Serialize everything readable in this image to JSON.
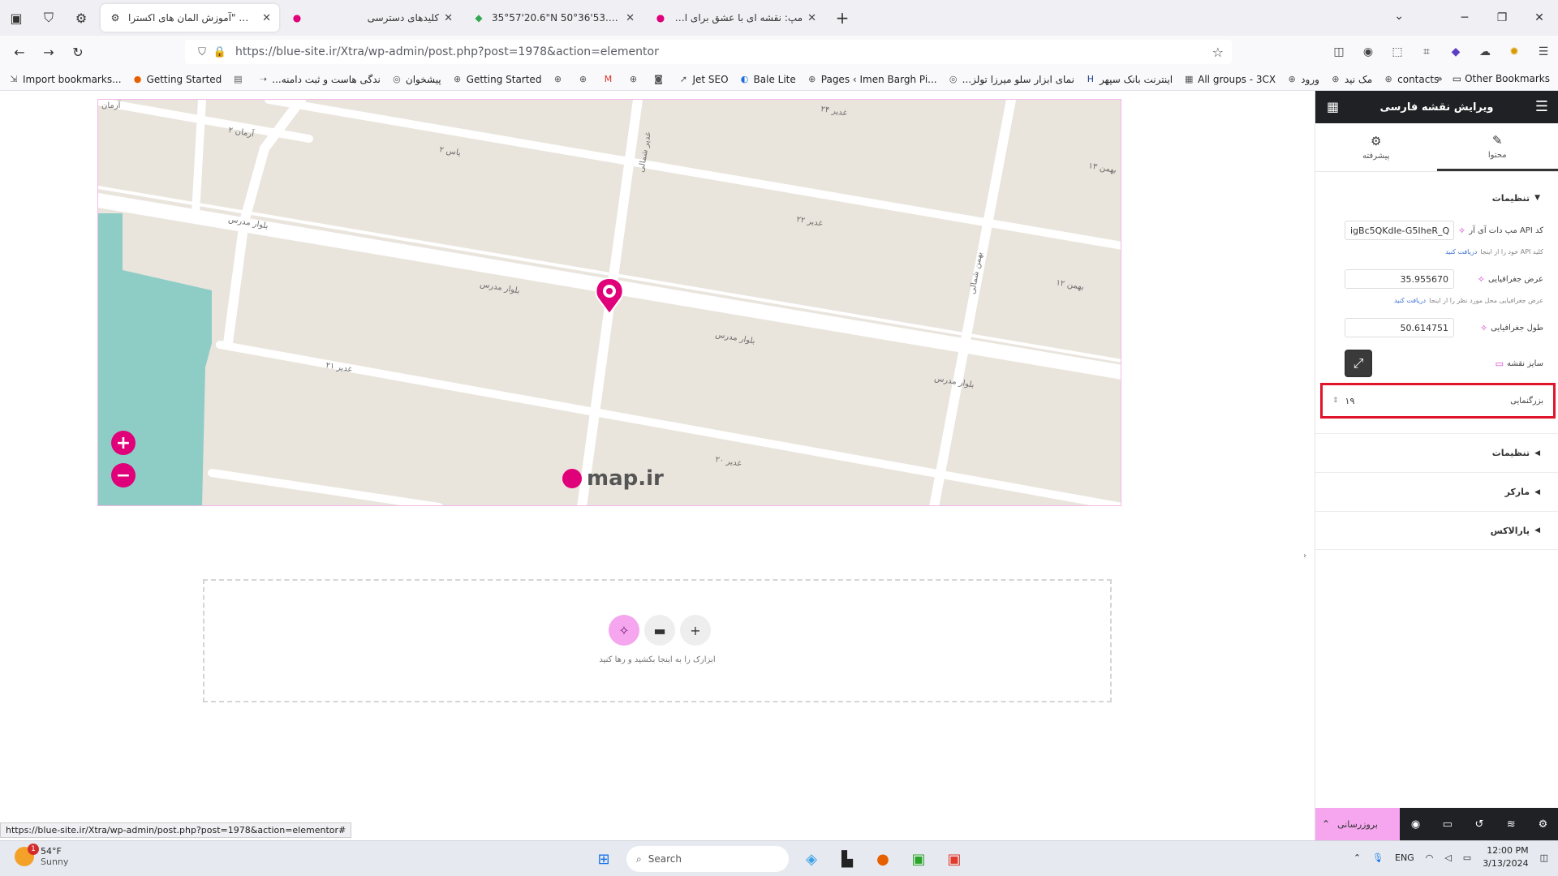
{
  "browser": {
    "tabs": [
      {
        "title": "ویرایش \"آموزش المان های اکسترا - ..."
      },
      {
        "title": "کلیدهای دسترسی"
      },
      {
        "title": "35°57'20.6\"N 50°36'53.2\"E - Goo"
      },
      {
        "title": "مپ: نقشه ای با عشق برای ایران"
      }
    ],
    "url": "https://blue-site.ir/Xtra/wp-admin/post.php?post=1978&action=elementor",
    "bookmarks": [
      "Import bookmarks...",
      "Getting Started",
      "...ندگی هاست و ثبت دامنه",
      "پیشخوان",
      "Getting Started",
      "Jet SEO",
      "Bale Lite",
      "Pages ‹ Imen Bargh Pi...",
      "...نمای ابزار سلو میرزا تولز",
      "اینترنت بانک سپهر",
      "All groups - 3CX",
      "ورود",
      "مک نید",
      "contacts"
    ],
    "other_bookmarks": "Other Bookmarks",
    "status_url": "https://blue-site.ir/Xtra/wp-admin/post.php?post=1978&action=elementor#"
  },
  "map": {
    "streets": [
      "آرمان",
      "آرمان ۲",
      "یاس ۲",
      "بلوار مدرس",
      "بلوار مدرس",
      "بلوار مدرس",
      "بلوار مدرس",
      "غدیر ۲۴",
      "غدیر ۲۲",
      "غدیر ۲۱",
      "غدیر ۲۰",
      "بهمن ۱۳",
      "بهمن ۱۲",
      "بهمن شمالی",
      "غدیر شمالی"
    ],
    "logo": "map.ir",
    "accent": "#e0007a"
  },
  "dropzone": {
    "hint": "ابزارک را به اینجا بکشید و رها کنید"
  },
  "panel": {
    "title": "ویرایش نقشه فارسی",
    "tab_content": "محتوا",
    "tab_advanced": "پیشرفته",
    "section_settings": "تنظیمات",
    "api_label": "کد API مپ دات آی آر",
    "api_value": "igBc5QKdIe-G5IheR_Q",
    "api_hint": "کلید API خود را از اینجا",
    "api_hint_link": "دریافت کنید",
    "lat_label": "عرض جغرافیایی",
    "lat_value": "35.955670",
    "lat_hint": "عرض جغرافیایی محل مورد نظر را از اینجا",
    "lat_hint_link": "دریافت کنید",
    "lng_label": "طول جغرافیایی",
    "lng_value": "50.614751",
    "size_label": "سایز نقشه",
    "zoom_label": "بزرگنمایی",
    "zoom_value": "۱۹",
    "collapsed_sections": [
      "تنظیمات",
      "مارکر",
      "پارالاکس"
    ],
    "publish": "بروزرسانی"
  },
  "taskbar": {
    "temp": "54°F",
    "weather": "Sunny",
    "badge": "1",
    "search": "Search",
    "lang": "ENG",
    "time": "12:00 PM",
    "date": "3/13/2024"
  }
}
